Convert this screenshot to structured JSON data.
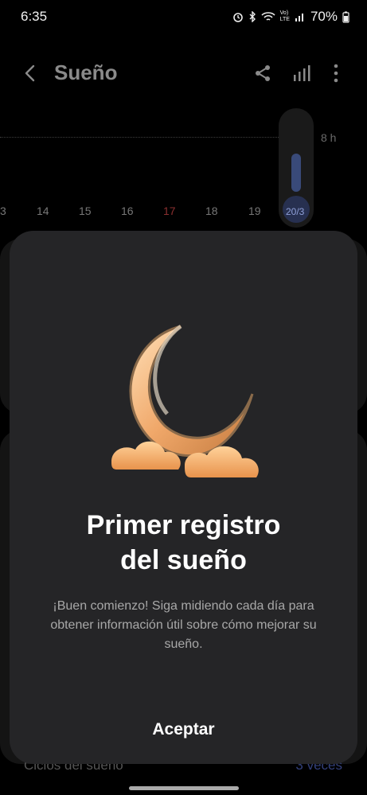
{
  "status": {
    "time": "6:35",
    "battery": "70%",
    "net_label_top": "Vo)",
    "net_label_bottom": "LTE"
  },
  "header": {
    "title": "Sueño",
    "back_icon": "back-arrow-icon",
    "share_icon": "share-icon",
    "chart_icon": "bar-chart-icon",
    "more_icon": "more-vertical-icon"
  },
  "chart": {
    "hours_label": "8 h",
    "days": [
      "3",
      "14",
      "15",
      "16",
      "17",
      "18",
      "19",
      "20/3"
    ],
    "selected_day": "20/3",
    "highlight_day": "17",
    "bar_color": "#394a79"
  },
  "background": {
    "cycles_label": "Ciclos del sueño",
    "cycles_value": "3 veces"
  },
  "dialog": {
    "illustration": "moon-cloud-icon",
    "title_line1": "Primer registro",
    "title_line2": "del sueño",
    "description": "¡Buen comienzo! Siga midiendo cada día para obtener información útil sobre cómo mejorar su sueño.",
    "accept_label": "Aceptar"
  }
}
